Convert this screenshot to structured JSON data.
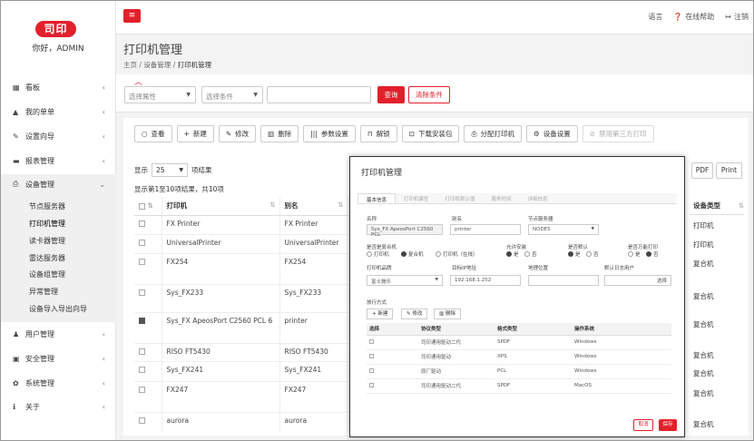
{
  "sidebar": {
    "logo": "司印",
    "greeting": "你好，ADMIN",
    "menu": [
      {
        "icon": "▦",
        "label": "看板"
      },
      {
        "icon": "▲",
        "label": "我的单单"
      },
      {
        "icon": "✎",
        "label": "设置向导"
      },
      {
        "icon": "▬",
        "label": "报表管理"
      },
      {
        "icon": "⎙",
        "label": "设备管理"
      },
      {
        "icon": "♟",
        "label": "用户管理"
      },
      {
        "icon": "▣",
        "label": "安全管理"
      },
      {
        "icon": "✿",
        "label": "系统管理"
      },
      {
        "icon": "ℹ",
        "label": "关于"
      }
    ],
    "submenu": [
      "节点服务器",
      "打印机管理",
      "读卡器管理",
      "雷达服务器",
      "设备组管理",
      "异常管理",
      "设备导入导出向导"
    ]
  },
  "topbar": {
    "menu_icon": "≡",
    "lang": "语言",
    "help": "在线帮助",
    "logout": "注销"
  },
  "page": {
    "title": "打印机管理",
    "crumb_home": "主页",
    "crumb_device": "设备管理",
    "crumb_current": "打印机管理"
  },
  "filter": {
    "prop_placeholder": "选择属性",
    "cond_placeholder": "选择条件",
    "query": "查询",
    "clear": "清除条件"
  },
  "toolbar": [
    {
      "icon": "○",
      "label": "查看"
    },
    {
      "icon": "+",
      "label": "新建"
    },
    {
      "icon": "✎",
      "label": "修改"
    },
    {
      "icon": "▥",
      "label": "删除"
    },
    {
      "icon": "|||",
      "label": "参数设置"
    },
    {
      "icon": "⊓",
      "label": "解锁"
    },
    {
      "icon": "⊡",
      "label": "下载安装包"
    },
    {
      "icon": "⎙",
      "label": "分配打印机"
    },
    {
      "icon": "⚙",
      "label": "设备设置"
    },
    {
      "icon": "⊘",
      "label": "禁用第三方打印"
    }
  ],
  "list": {
    "show_label": "显示",
    "page_size": "25",
    "records_label": "项结果",
    "info": "显示第1至10项结果，共10项",
    "pdf": "PDF",
    "print": "Print"
  },
  "table": {
    "headers": [
      "打印机",
      "别名"
    ],
    "rows": [
      {
        "name": "FX Printer",
        "alias": "FX Printer",
        "type": "打印机",
        "checked": false
      },
      {
        "name": "UniversalPrinter",
        "alias": "UniversalPrinter",
        "type": "打印机",
        "checked": false
      },
      {
        "name": "FX254",
        "alias": "FX254",
        "type": "复合机",
        "checked": false
      },
      {
        "name": "Sys_FX233",
        "alias": "Sys_FX233",
        "type": "复合机",
        "checked": false
      },
      {
        "name": "Sys_FX ApeosPort C2560 PCL 6",
        "alias": "printer",
        "type": "复合机",
        "checked": true
      },
      {
        "name": "RISO FT5430",
        "alias": "RISO FT5430",
        "type": "复合机",
        "checked": false
      },
      {
        "name": "Sys_FX241",
        "alias": "Sys_FX241",
        "type": "复合机",
        "checked": false
      },
      {
        "name": "FX247",
        "alias": "FX247",
        "type": "复合机",
        "checked": false
      },
      {
        "name": "aurora",
        "alias": "aurora",
        "type": "复合机",
        "checked": false
      }
    ],
    "type_header": "设备类型"
  },
  "modal": {
    "title": "打印机管理",
    "tabs": [
      "基本信息",
      "打印机属性",
      "打印机默认值",
      "服务时间",
      "详细信息"
    ],
    "name_label": "名称",
    "name_value": "Sys_FX ApeosPort C2560 PCL",
    "alias_label": "别名",
    "alias_value": "printer",
    "node_label": "节点服务器",
    "node_value": "NODE5",
    "is_mfp_label": "是否是复合机",
    "opt_printer": "打印机",
    "opt_mfp": "复合机",
    "opt_online": "打印机（在线）",
    "allow_install_label": "允许安装",
    "yes": "是",
    "no": "否",
    "is_default_label": "是否默认",
    "is_universal_label": "是否万能打印",
    "brand_label": "打印机品牌",
    "brand_value": "富士施乐",
    "ip_label": "目标IP地址",
    "ip_value": "192.168.1.252",
    "location_label": "地理位置",
    "default_user_label": "默认日志用户",
    "select": "选择",
    "release_label": "放行方式",
    "btn_new": "新建",
    "btn_edit": "修改",
    "btn_delete": "删除",
    "sub_headers": [
      "选择",
      "协议类型",
      "格式类型",
      "操作系统"
    ],
    "sub_rows": [
      [
        "司印通用驱动二代",
        "SPDF",
        "Windows"
      ],
      [
        "司印通用驱动",
        "XPS",
        "Windows"
      ],
      [
        "原厂驱动",
        "PCL",
        "Windows"
      ],
      [
        "司印通用驱动二代",
        "SPDF",
        "MacOS"
      ]
    ],
    "cancel": "取消",
    "save": "保存"
  }
}
